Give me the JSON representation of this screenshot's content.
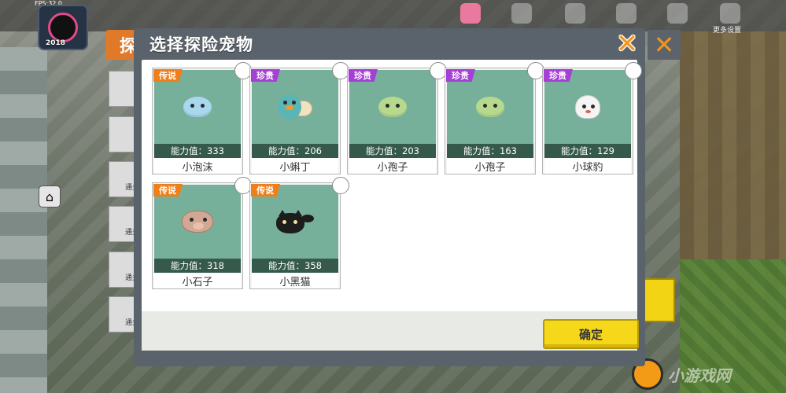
{
  "hud": {
    "fps": "FPS:32.0",
    "level": "2018",
    "top_labels": [
      "更多设置"
    ],
    "background_title": "探",
    "left_panel_labels": [
      "通关",
      "通关",
      "通关",
      "通关"
    ]
  },
  "dialog": {
    "title": "选择探险宠物",
    "close_icon": "close-x-icon",
    "confirm_label": "确定"
  },
  "pets": [
    {
      "rarity": "传说",
      "rarity_kind": "legend",
      "power": "能力值：333",
      "name": "小泡沫",
      "color": "#a9d8ee",
      "shape": "blob"
    },
    {
      "rarity": "珍贵",
      "rarity_kind": "rare",
      "power": "能力值：206",
      "name": "小蝌丁",
      "color": "#5bb5b4",
      "shape": "tadpole"
    },
    {
      "rarity": "珍贵",
      "rarity_kind": "rare",
      "power": "能力值：203",
      "name": "小孢子",
      "color": "#b6d98e",
      "shape": "blob"
    },
    {
      "rarity": "珍贵",
      "rarity_kind": "rare",
      "power": "能力值：163",
      "name": "小孢子",
      "color": "#b6d98e",
      "shape": "blob"
    },
    {
      "rarity": "珍贵",
      "rarity_kind": "rare",
      "power": "能力值：129",
      "name": "小球豹",
      "color": "#f5f5f5",
      "shape": "seal"
    },
    {
      "rarity": "传说",
      "rarity_kind": "legend",
      "power": "能力值：318",
      "name": "小石子",
      "color": "#d2a793",
      "shape": "pig"
    },
    {
      "rarity": "传说",
      "rarity_kind": "legend",
      "power": "能力值：358",
      "name": "小黑猫",
      "color": "#1d1d1d",
      "shape": "cat"
    }
  ],
  "watermark": "小游戏网"
}
